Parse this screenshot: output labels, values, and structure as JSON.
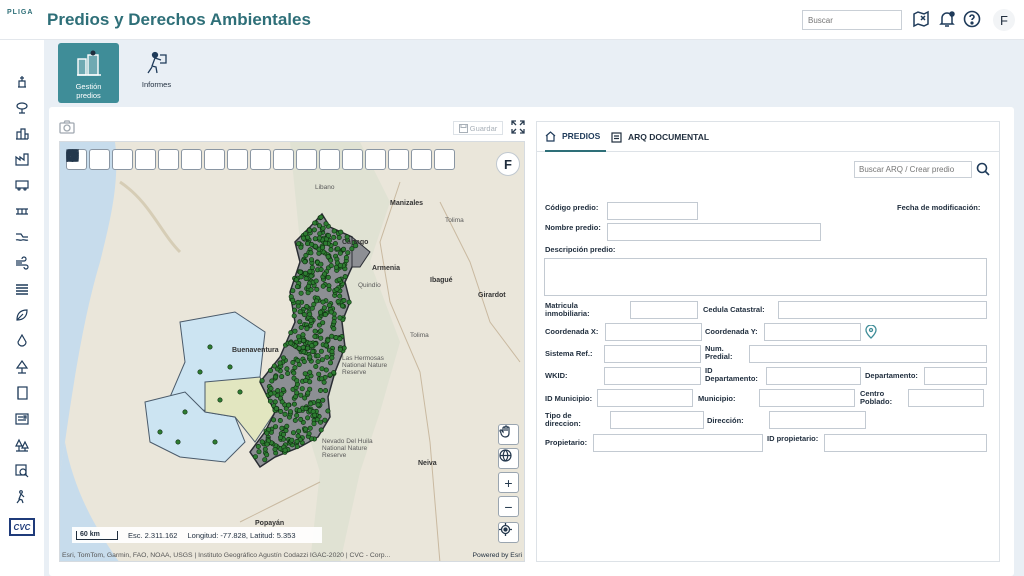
{
  "app": {
    "logo": "PLIGA",
    "title": "Predios y Derechos Ambientales",
    "search_placeholder": "Buscar",
    "avatar": "F"
  },
  "modules": [
    {
      "label_line1": "Gestión",
      "label_line2": "predios",
      "icon": "property-management-icon",
      "active": true
    },
    {
      "label_line1": "Informes",
      "label_line2": "",
      "icon": "reports-icon",
      "active": false
    }
  ],
  "map": {
    "save_label": "Guardar",
    "f_button": "F",
    "scale_bar": "60 km",
    "scale_text": "Esc. 2.311.162",
    "coords_text": "Longitud: -77.828, Latitud: 5.353",
    "attribution": "Esri, TomTom, Garmin, FAO, NOAA, USGS | Instituto Geográfico Agustín Codazzi IGAC-2020 | CVC - Corp...",
    "powered_by": "Powered by Esri",
    "cities": [
      "Manizales",
      "Cartago",
      "Armenia",
      "Tolima",
      "Ibagué",
      "Girardot",
      "Buenaventura",
      "Nevado Del Huila National Nature Reserve",
      "Neiva",
      "Popayán",
      "Libano",
      "Quindío",
      "Las Hermosas National Nature Reserve",
      "Tolima"
    ]
  },
  "form": {
    "tabs": [
      "PREDIOS",
      "ARQ DOCUMENTAL"
    ],
    "arq_search_placeholder": "Buscar ARQ / Crear predio",
    "labels": {
      "codigo": "Código predio:",
      "fecha_mod": "Fecha de modificación:",
      "nombre": "Nombre predio:",
      "descripcion": "Descripción predio:",
      "matricula": "Matricula inmobiliaria:",
      "cedula": "Cedula Catastral:",
      "coord_x": "Coordenada X:",
      "coord_y": "Coordenada Y:",
      "sistema": "Sistema Ref.:",
      "num_predial": "Num. Predial:",
      "wkid": "WKID:",
      "id_depto": "ID Departamento:",
      "depto": "Departamento:",
      "id_mun": "ID Municipio:",
      "municipio": "Municipio:",
      "centro": "Centro Poblado:",
      "tipo_dir": "Tipo de direccion:",
      "direccion": "Dirección:",
      "propietario": "Propietario:",
      "id_prop": "ID propietario:"
    }
  }
}
